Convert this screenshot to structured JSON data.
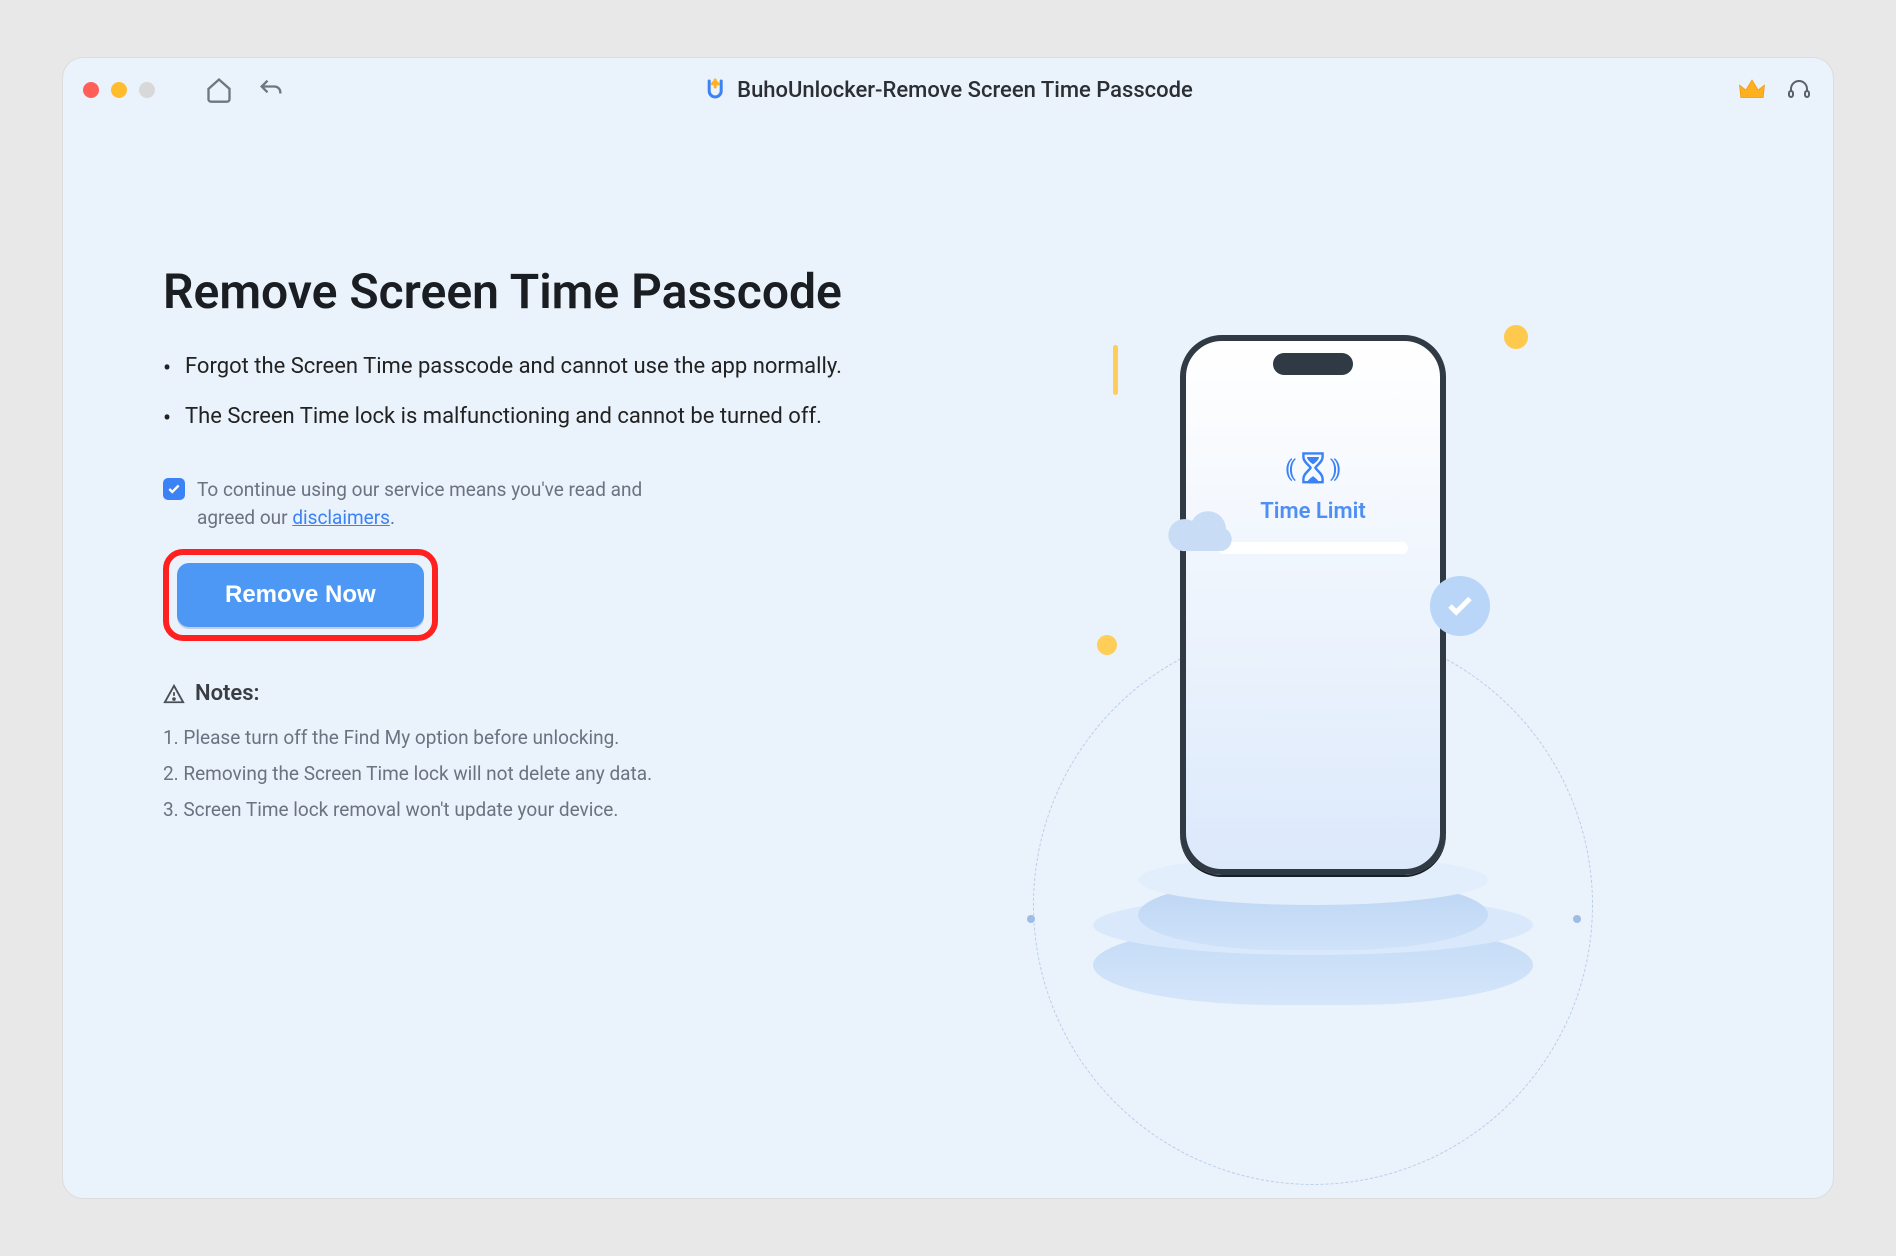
{
  "titlebar": {
    "title": "BuhoUnlocker-Remove Screen Time Passcode"
  },
  "main": {
    "heading": "Remove Screen Time Passcode",
    "bullets": [
      "Forgot the Screen Time passcode and cannot use the app normally.",
      "The Screen Time lock is malfunctioning and cannot be turned off."
    ],
    "agree": {
      "prefix": "To continue using our service means you've read and agreed our ",
      "link": "disclaimers",
      "suffix": "."
    },
    "cta": "Remove Now",
    "notes_label": "Notes:",
    "notes": [
      "1. Please turn off the Find My option before unlocking.",
      "2. Removing the Screen Time lock will not delete any data.",
      "3. Screen Time lock removal won't update your device."
    ]
  },
  "illustration": {
    "phone_label": "Time Limit"
  }
}
